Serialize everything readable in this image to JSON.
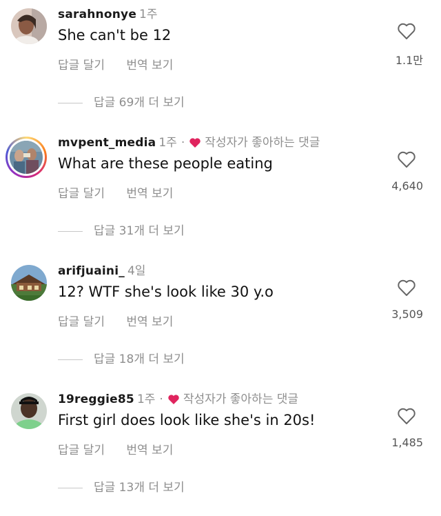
{
  "comments": [
    {
      "username": "sarahnonye",
      "time": "1주",
      "author_liked": false,
      "text": "She can't be 12",
      "reply_label": "답글 달기",
      "translate_label": "번역 보기",
      "like_count": "1.1만",
      "view_replies": "답글 69개 더 보기"
    },
    {
      "username": "mvpent_media",
      "time": "1주",
      "separator": "·",
      "author_liked": true,
      "liked_label": "작성자가 좋아하는 댓글",
      "text": "What are these people eating",
      "reply_label": "답글 달기",
      "translate_label": "번역 보기",
      "like_count": "4,640",
      "view_replies": "답글 31개 더 보기"
    },
    {
      "username": "arifjuaini_",
      "time": "4일",
      "author_liked": false,
      "text": "12? WTF she's look like 30 y.o",
      "reply_label": "답글 달기",
      "translate_label": "번역 보기",
      "like_count": "3,509",
      "view_replies": "답글 18개 더 보기"
    },
    {
      "username": "19reggie85",
      "time": "1주",
      "separator": "·",
      "author_liked": true,
      "liked_label": "작성자가 좋아하는 댓글",
      "text": "First girl does look like she's in 20s!",
      "reply_label": "답글 달기",
      "translate_label": "번역 보기",
      "like_count": "1,485",
      "view_replies": "답글 13개 더 보기"
    }
  ],
  "colors": {
    "liked_heart": "#e0245e",
    "secondary_text": "#8e8e8e"
  },
  "icons": {
    "like": "heart-outline-icon",
    "author_liked": "heart-filled-icon"
  }
}
